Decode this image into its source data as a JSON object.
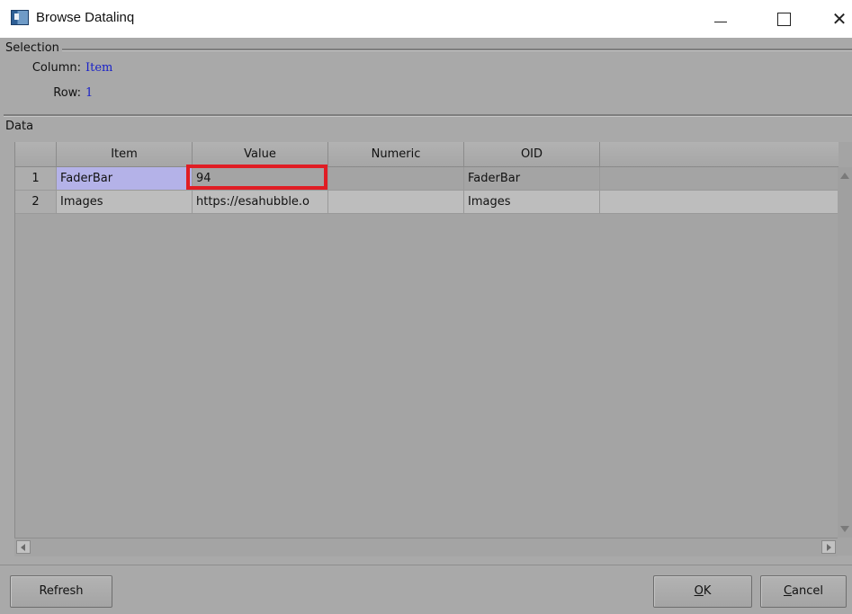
{
  "window": {
    "title": "Browse Datalinq",
    "icon": "app-icon",
    "controls": {
      "minimize": "minimize-icon",
      "maximize": "maximize-icon",
      "close": "close-icon"
    }
  },
  "selection": {
    "group_label": "Selection",
    "column_label": "Column:",
    "column_value": "Item",
    "row_label": "Row:",
    "row_value": "1"
  },
  "data_group": {
    "label": "Data",
    "columns": [
      "Item",
      "Value",
      "Numeric",
      "OID"
    ],
    "rows": [
      {
        "num": "1",
        "item": "FaderBar",
        "value": "94",
        "numeric": "",
        "oid": "FaderBar"
      },
      {
        "num": "2",
        "item": "Images",
        "value": "https://esahubble.o",
        "numeric": "",
        "oid": "Images"
      }
    ],
    "selected_cell": {
      "row": "1",
      "column": "Item"
    },
    "highlighted_cell": {
      "row": "1",
      "column": "Value"
    }
  },
  "buttons": {
    "refresh": "Refresh",
    "ok": "OK",
    "ok_mnemonic": "O",
    "ok_rest": "K",
    "cancel": "Cancel",
    "cancel_mnemonic": "C",
    "cancel_rest": "ancel"
  },
  "colors": {
    "background": "#a9a9a9",
    "selected_cell": "#b4b2e8",
    "highlight_box": "#e01d24",
    "selection_value_text": "#1a22c8"
  }
}
